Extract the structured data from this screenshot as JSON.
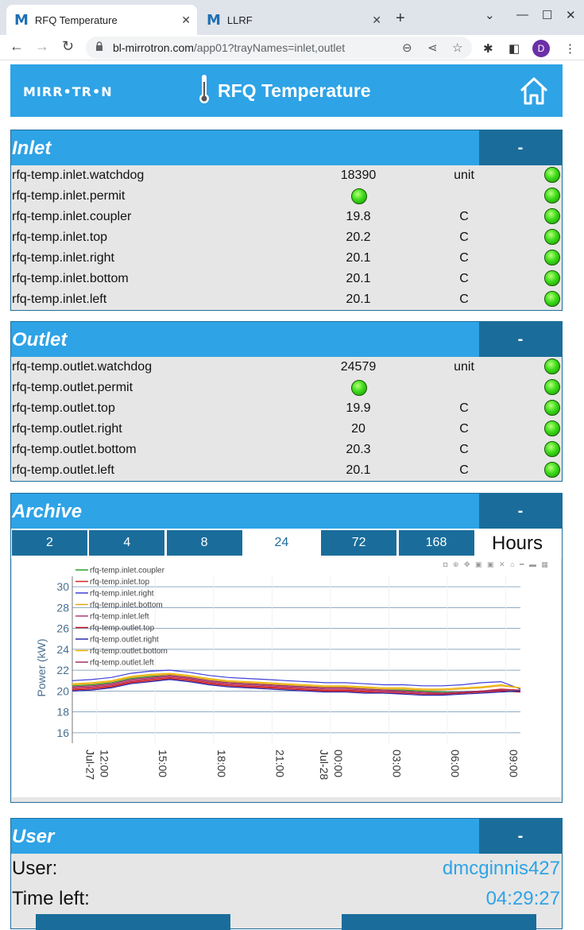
{
  "browser": {
    "tabs": [
      {
        "title": "RFQ Temperature",
        "favicon": "M"
      },
      {
        "title": "LLRF",
        "favicon": "M"
      }
    ],
    "url_host": "bl-mirrotron.com",
    "url_rest": "/app01?trayNames=inlet,outlet",
    "profile_initial": "D"
  },
  "header": {
    "logo": "MIRR•TR•N",
    "title": "RFQ Temperature"
  },
  "inlet": {
    "title": "Inlet",
    "collapse": "-",
    "rows": [
      {
        "name": "rfq-temp.inlet.watchdog",
        "value": "18390",
        "unit": "unit"
      },
      {
        "name": "rfq-temp.inlet.permit",
        "value": "",
        "unit": ""
      },
      {
        "name": "rfq-temp.inlet.coupler",
        "value": "19.8",
        "unit": "C"
      },
      {
        "name": "rfq-temp.inlet.top",
        "value": "20.2",
        "unit": "C"
      },
      {
        "name": "rfq-temp.inlet.right",
        "value": "20.1",
        "unit": "C"
      },
      {
        "name": "rfq-temp.inlet.bottom",
        "value": "20.1",
        "unit": "C"
      },
      {
        "name": "rfq-temp.inlet.left",
        "value": "20.1",
        "unit": "C"
      }
    ]
  },
  "outlet": {
    "title": "Outlet",
    "collapse": "-",
    "rows": [
      {
        "name": "rfq-temp.outlet.watchdog",
        "value": "24579",
        "unit": "unit"
      },
      {
        "name": "rfq-temp.outlet.permit",
        "value": "",
        "unit": ""
      },
      {
        "name": "rfq-temp.outlet.top",
        "value": "19.9",
        "unit": "C"
      },
      {
        "name": "rfq-temp.outlet.right",
        "value": "20",
        "unit": "C"
      },
      {
        "name": "rfq-temp.outlet.bottom",
        "value": "20.3",
        "unit": "C"
      },
      {
        "name": "rfq-temp.outlet.left",
        "value": "20.1",
        "unit": "C"
      }
    ]
  },
  "archive": {
    "title": "Archive",
    "collapse": "-",
    "hour_buttons": [
      "2",
      "4",
      "8",
      "24",
      "72",
      "168"
    ],
    "selected_hours": "24",
    "hours_label": "Hours"
  },
  "user": {
    "title": "User",
    "collapse": "-",
    "user_label": "User:",
    "user_value": "dmcginnis427",
    "time_label": "Time left:",
    "time_value": "04:29:27"
  },
  "chart_data": {
    "type": "line",
    "title": "",
    "xlabel": "",
    "ylabel": "Power (kW)",
    "ylim": [
      15,
      31
    ],
    "yticks": [
      16,
      18,
      20,
      22,
      24,
      26,
      28,
      30
    ],
    "xticks": [
      {
        "t": "12:00",
        "sub": "Jul-27"
      },
      {
        "t": "15:00",
        "sub": ""
      },
      {
        "t": "18:00",
        "sub": ""
      },
      {
        "t": "21:00",
        "sub": ""
      },
      {
        "t": "00:00",
        "sub": "Jul-28"
      },
      {
        "t": "03:00",
        "sub": ""
      },
      {
        "t": "06:00",
        "sub": ""
      },
      {
        "t": "09:00",
        "sub": ""
      }
    ],
    "x_hours": [
      0,
      1,
      2,
      3,
      4,
      5,
      6,
      7,
      8,
      9,
      10,
      11,
      12,
      13,
      14,
      15,
      16,
      17,
      18,
      19,
      20,
      21,
      22,
      23
    ],
    "x_start_label": "Jul-27 10:45",
    "grid": true,
    "legend": "top-left",
    "series": [
      {
        "name": "rfq-temp.inlet.coupler",
        "color": "#2ca02c",
        "values": [
          20.5,
          20.6,
          20.8,
          21.2,
          21.4,
          21.5,
          21.3,
          21.0,
          20.8,
          20.7,
          20.6,
          20.5,
          20.4,
          20.3,
          20.3,
          20.2,
          20.1,
          20.1,
          20.0,
          19.9,
          19.9,
          20.0,
          20.1,
          20.0
        ]
      },
      {
        "name": "rfq-temp.inlet.top",
        "color": "#d62728",
        "values": [
          20.2,
          20.3,
          20.5,
          20.9,
          21.1,
          21.3,
          21.1,
          20.8,
          20.6,
          20.5,
          20.4,
          20.3,
          20.2,
          20.1,
          20.1,
          20.0,
          19.9,
          19.9,
          19.8,
          19.8,
          19.9,
          20.0,
          20.2,
          20.1
        ]
      },
      {
        "name": "rfq-temp.inlet.right",
        "color": "#3f3fd8",
        "values": [
          21.0,
          21.1,
          21.3,
          21.7,
          21.9,
          22.0,
          21.8,
          21.5,
          21.3,
          21.2,
          21.1,
          21.0,
          20.9,
          20.8,
          20.8,
          20.7,
          20.6,
          20.6,
          20.5,
          20.5,
          20.6,
          20.8,
          20.9,
          20.2
        ]
      },
      {
        "name": "rfq-temp.inlet.bottom",
        "color": "#e6a817",
        "values": [
          20.6,
          20.7,
          20.9,
          21.3,
          21.5,
          21.6,
          21.4,
          21.1,
          20.9,
          20.8,
          20.7,
          20.6,
          20.5,
          20.4,
          20.4,
          20.3,
          20.2,
          20.2,
          20.1,
          20.1,
          20.2,
          20.3,
          20.5,
          20.3
        ]
      },
      {
        "name": "rfq-temp.inlet.left",
        "color": "#b03a7a",
        "values": [
          20.3,
          20.4,
          20.6,
          21.0,
          21.2,
          21.4,
          21.2,
          20.9,
          20.7,
          20.6,
          20.5,
          20.4,
          20.3,
          20.2,
          20.2,
          20.1,
          20.0,
          19.9,
          19.8,
          19.7,
          19.8,
          20.0,
          20.1,
          20.1
        ]
      },
      {
        "name": "rfq-temp.outlet.top",
        "color": "#c0141e",
        "values": [
          20.1,
          20.2,
          20.4,
          20.8,
          21.0,
          21.2,
          21.0,
          20.7,
          20.5,
          20.4,
          20.3,
          20.2,
          20.1,
          20.0,
          20.0,
          19.9,
          19.8,
          19.8,
          19.7,
          19.7,
          19.8,
          19.9,
          20.0,
          19.9
        ]
      },
      {
        "name": "rfq-temp.outlet.right",
        "color": "#2a2ab0",
        "values": [
          20.0,
          20.1,
          20.3,
          20.7,
          20.9,
          21.1,
          20.9,
          20.6,
          20.4,
          20.3,
          20.2,
          20.1,
          20.0,
          19.9,
          19.9,
          19.8,
          19.8,
          19.7,
          19.6,
          19.6,
          19.7,
          19.8,
          19.9,
          20.0
        ]
      },
      {
        "name": "rfq-temp.outlet.bottom",
        "color": "#f0b400",
        "values": [
          20.7,
          20.8,
          21.0,
          21.4,
          21.6,
          21.7,
          21.5,
          21.2,
          21.0,
          20.9,
          20.8,
          20.7,
          20.6,
          20.5,
          20.5,
          20.4,
          20.3,
          20.3,
          20.2,
          20.2,
          20.3,
          20.4,
          20.6,
          20.3
        ]
      },
      {
        "name": "rfq-temp.outlet.left",
        "color": "#a0306a",
        "values": [
          20.4,
          20.5,
          20.7,
          21.1,
          21.3,
          21.5,
          21.3,
          21.0,
          20.8,
          20.7,
          20.6,
          20.5,
          20.4,
          20.3,
          20.3,
          20.2,
          20.1,
          20.0,
          19.9,
          19.8,
          19.9,
          20.0,
          20.1,
          20.1
        ]
      }
    ]
  }
}
